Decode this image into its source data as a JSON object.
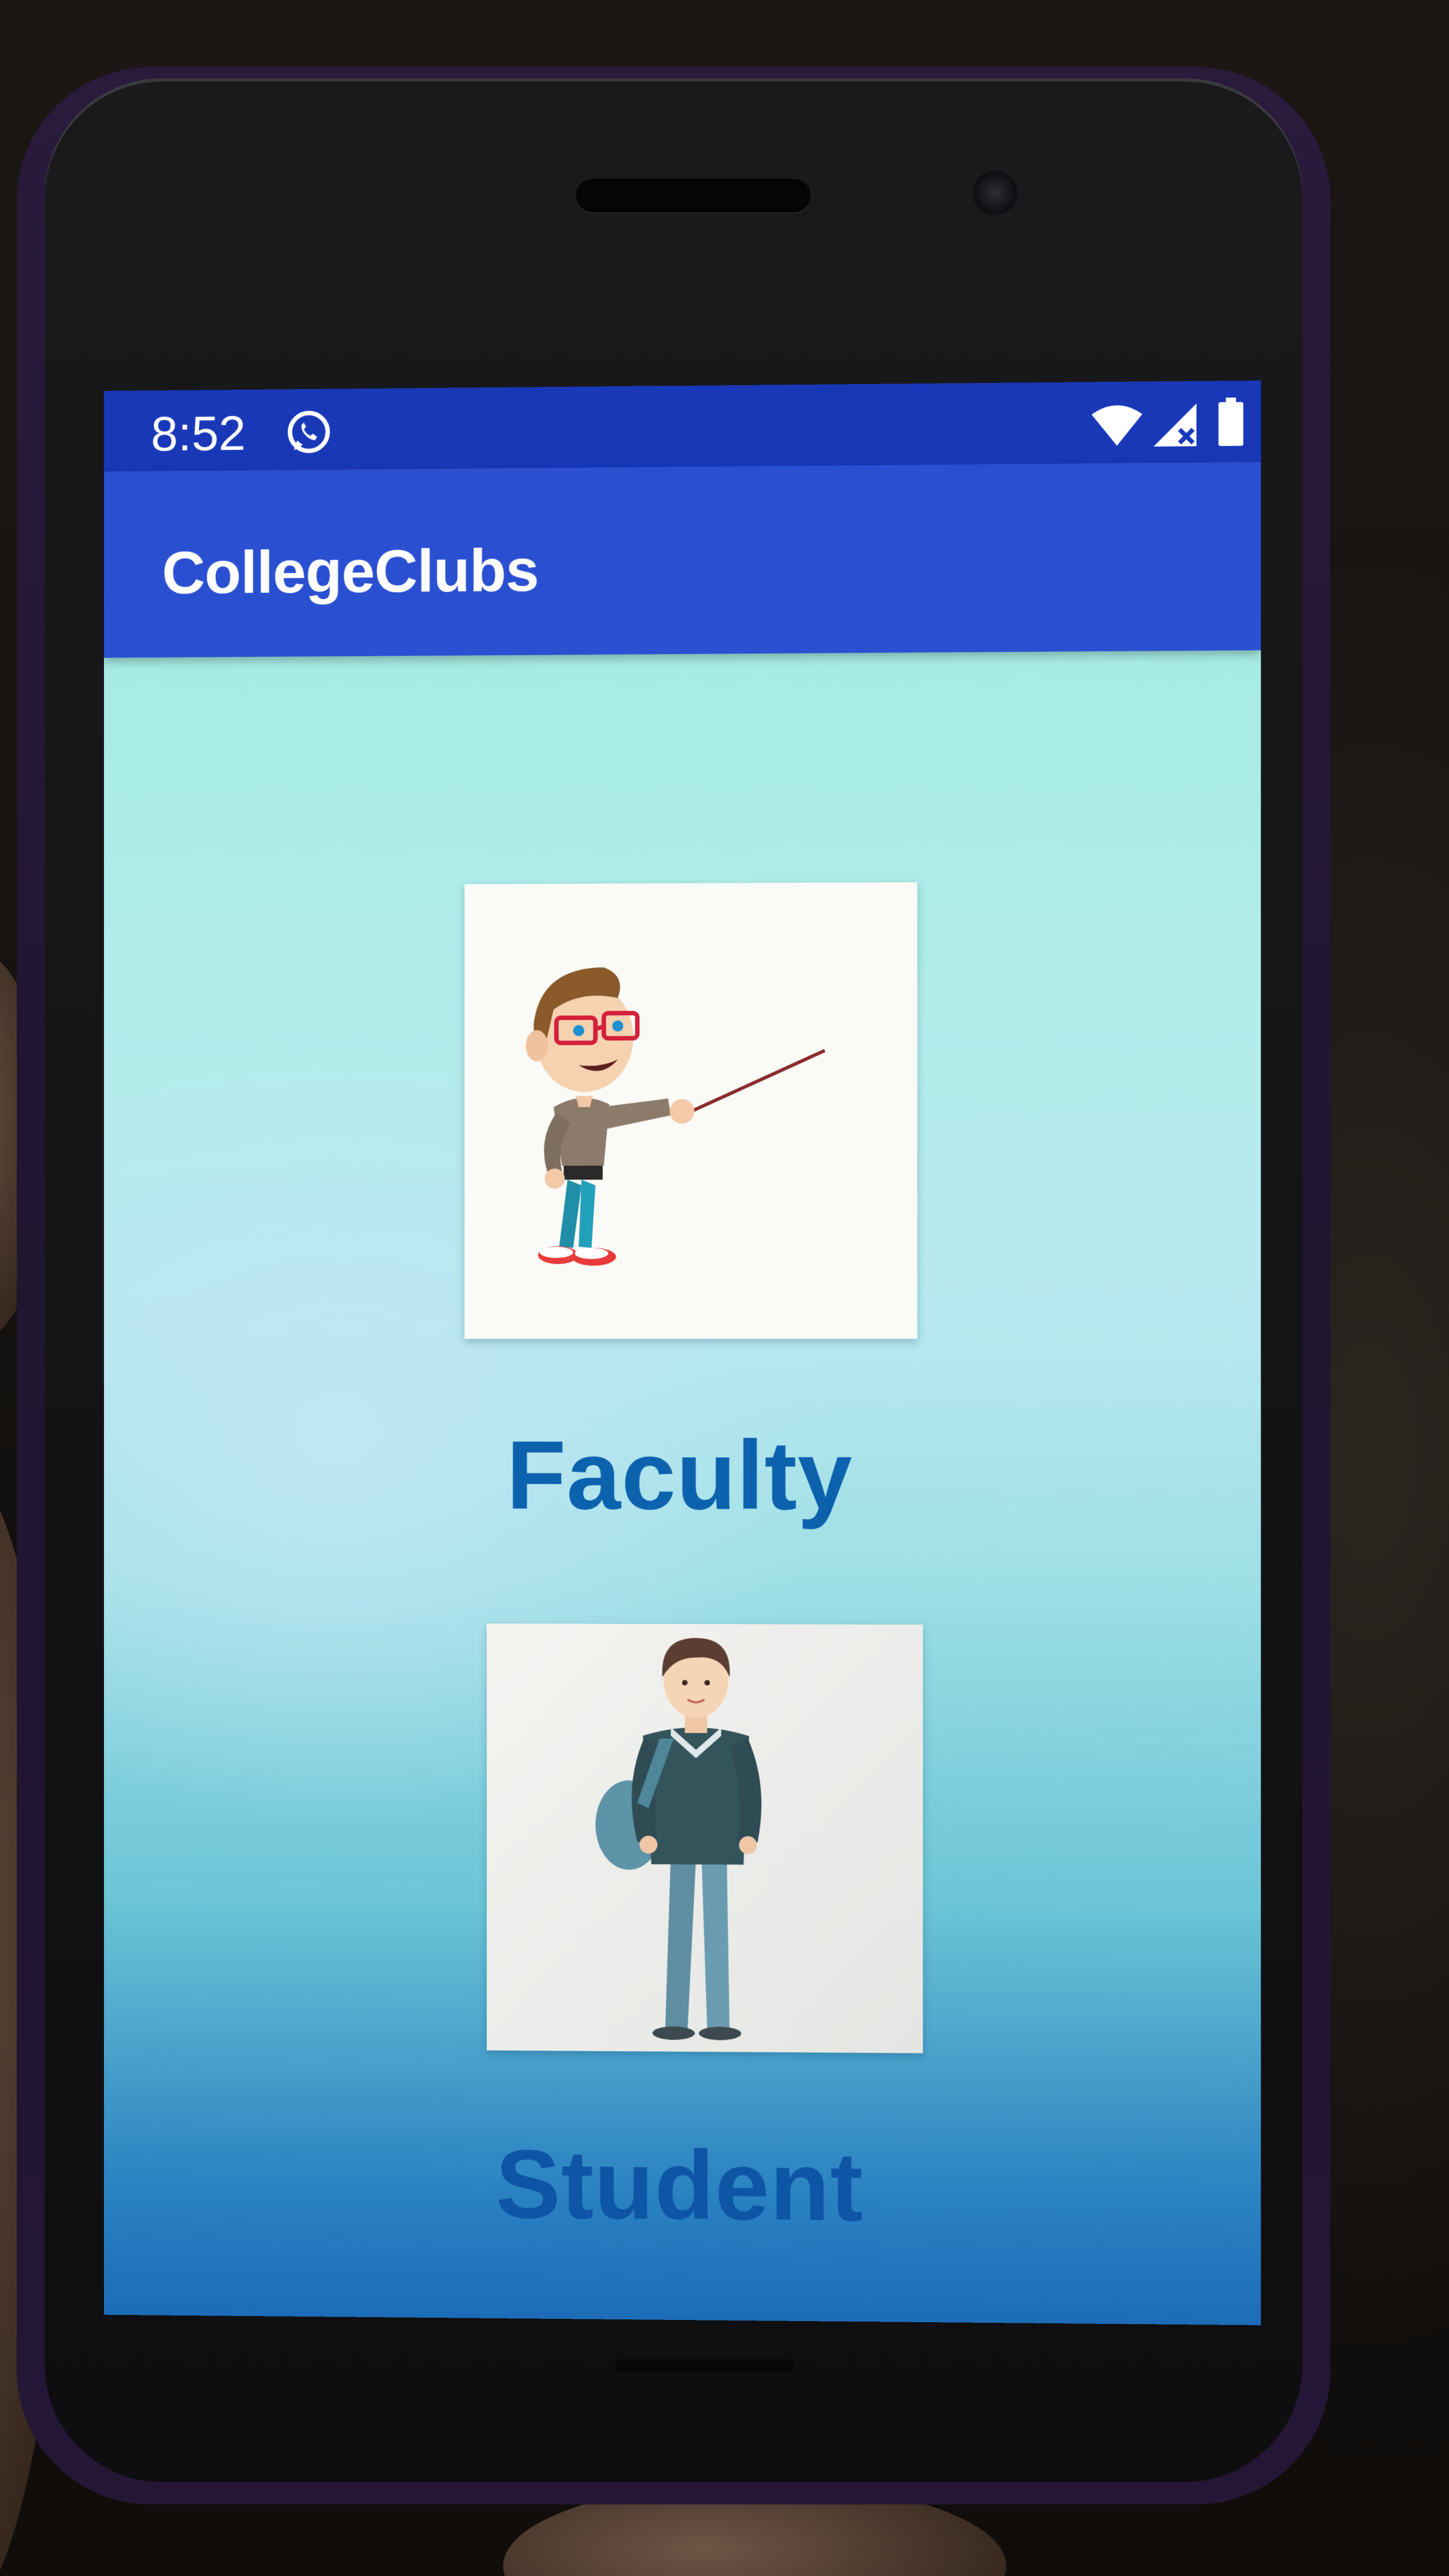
{
  "status_bar": {
    "time": "8:52",
    "icons": [
      "whatsapp-icon",
      "wifi-icon",
      "signal-icon",
      "battery-icon"
    ]
  },
  "app_bar": {
    "title": "CollegeClubs"
  },
  "roles": [
    {
      "label": "Faculty",
      "illustration": "teacher-with-pointer-illustration"
    },
    {
      "label": "Student",
      "illustration": "student-with-backpack-illustration"
    }
  ],
  "colors": {
    "status_bar": "#1838b8",
    "app_bar": "#2a51d2",
    "role_label": "#0d62ae",
    "background_top": "#a6ece4",
    "background_bottom": "#1d6cb8"
  }
}
